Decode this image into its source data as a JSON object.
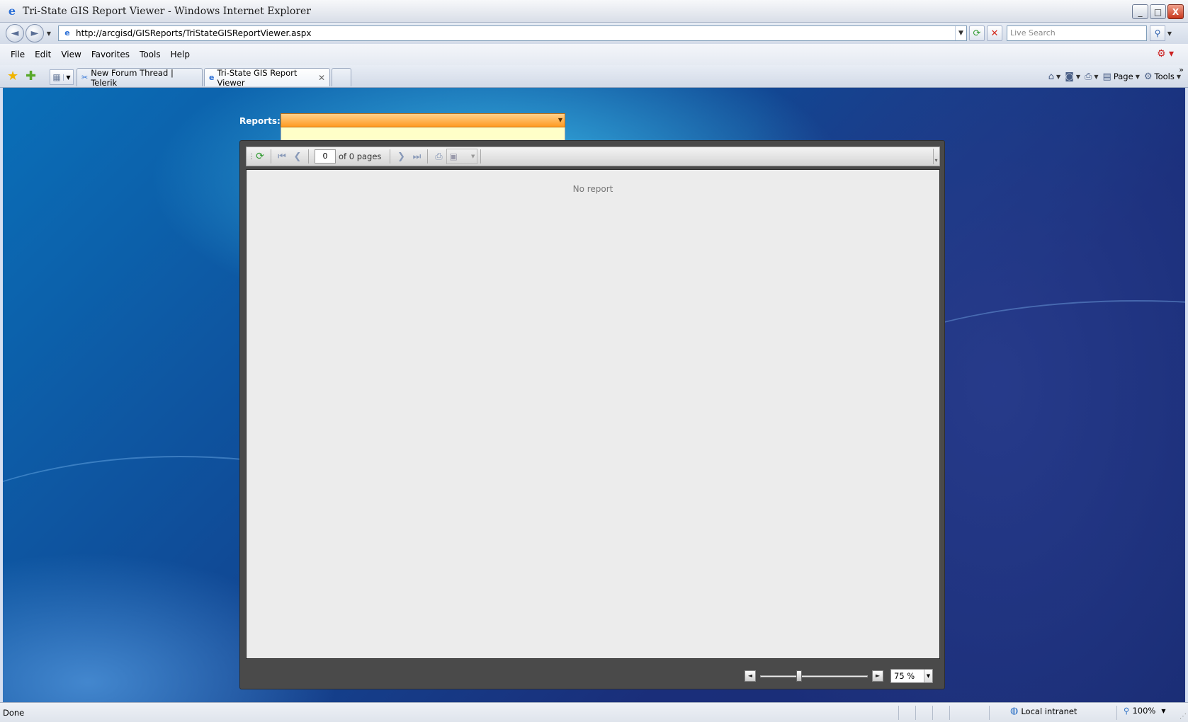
{
  "window": {
    "title": "Tri-State GIS Report Viewer - Windows Internet Explorer",
    "minimize_glyph": "_",
    "maximize_glyph": "□",
    "close_glyph": "X"
  },
  "address_bar": {
    "url": "http://arcgisd/GISReports/TriStateGISReportViewer.aspx",
    "search_placeholder": "Live Search"
  },
  "menu": {
    "items": [
      "File",
      "Edit",
      "View",
      "Favorites",
      "Tools",
      "Help"
    ]
  },
  "tabs": [
    {
      "label": "New Forum Thread | Telerik",
      "active": false
    },
    {
      "label": "Tri-State GIS Report Viewer",
      "active": true
    }
  ],
  "command_bar": {
    "page_label": "Page",
    "tools_label": "Tools"
  },
  "report_page": {
    "reports_label": "Reports:",
    "reports_selected": "",
    "accent_color": "#ff9a22"
  },
  "viewer": {
    "page_number": "0",
    "page_of": "of 0 pages",
    "empty_message": "No report",
    "zoom_value": "75 %",
    "zoom_slider_fraction": 0.36
  },
  "status_bar": {
    "status": "Done",
    "zone": "Local intranet",
    "zoom": "100%"
  },
  "icons": {
    "back": "back-arrow-icon",
    "forward": "forward-arrow-icon",
    "refresh": "refresh-icon",
    "stop": "stop-icon",
    "search": "search-icon",
    "favorites": "star-icon",
    "add_favorite": "add-favorite-icon",
    "home": "home-icon",
    "feeds": "feeds-icon",
    "print": "print-icon"
  }
}
